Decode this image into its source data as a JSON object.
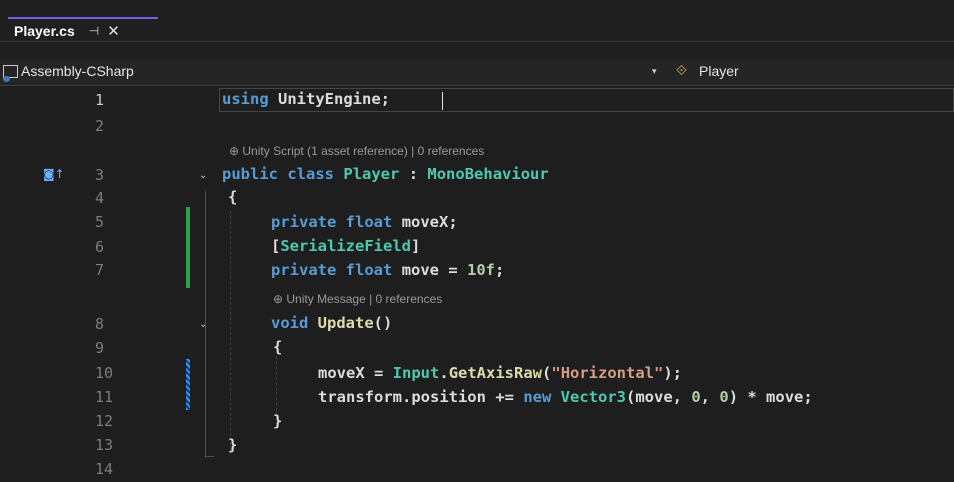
{
  "tab": {
    "title": "Player.cs",
    "pin_glyph": "⊣",
    "close_glyph": "✕"
  },
  "navbar": {
    "project": "Assembly-CSharp",
    "class_name": "Player",
    "dropdown_glyph": "▾",
    "class_icon": "class-icon"
  },
  "lens": {
    "class": "⊕ Unity Script (1 asset reference) | 0 references",
    "method": "⊕ Unity Message | 0 references"
  },
  "gutter": {
    "line3_marker": "◙↑"
  },
  "line_numbers": [
    "1",
    "2",
    "3",
    "4",
    "5",
    "6",
    "7",
    "8",
    "9",
    "10",
    "11",
    "12",
    "13",
    "14"
  ],
  "code": {
    "l1": {
      "using": "using",
      "ns": "UnityEngine",
      "semi": ";"
    },
    "l3": {
      "public": "public",
      "class": "class",
      "name": "Player",
      "colon": ":",
      "base": "MonoBehaviour"
    },
    "l4": "{",
    "l5": {
      "private": "private",
      "float": "float",
      "name": "moveX",
      "semi": ";"
    },
    "l6": {
      "open": "[",
      "attr": "SerializeField",
      "close": "]"
    },
    "l7": {
      "private": "private",
      "float": "float",
      "name": "move",
      "eq": " = ",
      "val": "10f",
      "semi": ";"
    },
    "l8": {
      "void": "void",
      "name": "Update",
      "parens": "()"
    },
    "l9": "{",
    "l10": {
      "lhs": "moveX",
      "eq": " = ",
      "cls": "Input",
      "dot": ".",
      "meth": "GetAxisRaw",
      "open": "(",
      "arg": "\"Horizontal\"",
      "close": ");"
    },
    "l11": {
      "obj": "transform.position",
      "op": " += ",
      "new": "new",
      "type": "Vector3",
      "open": "(",
      "a1": "move",
      "c1": ", ",
      "a2": "0",
      "c2": ", ",
      "a3": "0",
      "close": ")",
      "mul": " * ",
      "rhs": "move",
      "semi": ";"
    },
    "l12": "}",
    "l13": "}"
  },
  "colors": {
    "keyword": "#569cd6",
    "type": "#4ec9b0",
    "string": "#d69d85",
    "number": "#b5cea8",
    "method": "#dcdcaa",
    "accent": "#7160e8"
  }
}
